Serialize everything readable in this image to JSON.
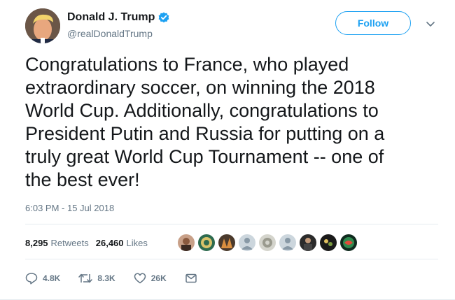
{
  "user": {
    "display_name": "Donald J. Trump",
    "screen_name": "@realDonaldTrump",
    "verified": true
  },
  "header": {
    "follow_label": "Follow"
  },
  "tweet": {
    "text": "Congratulations to France, who played\nextraordinary soccer, on winning the 2018\nWorld Cup. Additionally, congratulations to\nPresident Putin and Russia for putting on a\ntruly great World Cup Tournament -- one of\nthe best ever!",
    "timestamp": "6:03 PM - 15 Jul 2018"
  },
  "stats": {
    "retweets_count": "8,295",
    "retweets_label": "Retweets",
    "likes_count": "26,460",
    "likes_label": "Likes"
  },
  "actions": {
    "reply_count": "4.8K",
    "retweet_count": "8.3K",
    "like_count": "26K"
  },
  "colors": {
    "accent": "#1da1f2",
    "secondary_text": "#657786",
    "primary_text": "#14171a",
    "divider": "#e6ecf0"
  },
  "icons": [
    "verified-badge-icon",
    "chevron-down-icon",
    "reply-icon",
    "retweet-icon",
    "heart-icon",
    "envelope-icon"
  ]
}
